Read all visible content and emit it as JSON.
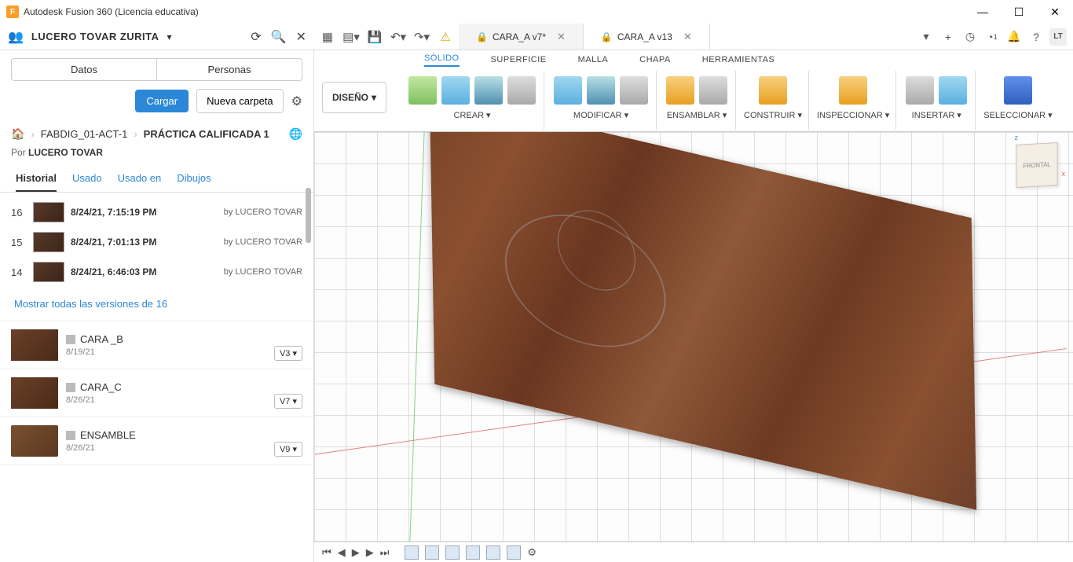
{
  "app": {
    "title": "Autodesk Fusion 360 (Licencia educativa)",
    "user_badge": "LT"
  },
  "user": {
    "name": "LUCERO TOVAR ZURITA"
  },
  "sidebar": {
    "tabs": {
      "datos": "Datos",
      "personas": "Personas"
    },
    "cargar": "Cargar",
    "nueva_carpeta": "Nueva carpeta",
    "breadcrumb": {
      "a": "FABDIG_01-ACT-1",
      "b": "PRÁCTICA CALIFICADA 1"
    },
    "por_prefix": "Por ",
    "por_name": "LUCERO TOVAR",
    "hist_tabs": {
      "historial": "Historial",
      "usado": "Usado",
      "usado_en": "Usado en",
      "dibujos": "Dibujos"
    },
    "versions": [
      {
        "num": "16",
        "date": "8/24/21, 7:15:19 PM",
        "by": "by LUCERO TOVAR"
      },
      {
        "num": "15",
        "date": "8/24/21, 7:01:13 PM",
        "by": "by LUCERO TOVAR"
      },
      {
        "num": "14",
        "date": "8/24/21, 6:46:03 PM",
        "by": "by LUCERO TOVAR"
      }
    ],
    "show_all": "Mostrar todas las versiones de 16",
    "files": [
      {
        "name": "CARA _B",
        "date": "8/19/21",
        "ver": "V3 ▾"
      },
      {
        "name": "CARA_C",
        "date": "8/26/21",
        "ver": "V7 ▾"
      },
      {
        "name": "ENSAMBLE",
        "date": "8/26/21",
        "ver": "V9 ▾"
      }
    ]
  },
  "file_tabs": {
    "tab1": "CARA_A v7*",
    "tab2": "CARA_A v13"
  },
  "ribbon": {
    "workspace": "DISEÑO",
    "tabs": {
      "solido": "SÓLIDO",
      "superficie": "SUPERFICIE",
      "malla": "MALLA",
      "chapa": "CHAPA",
      "herramientas": "HERRAMIENTAS"
    },
    "groups": {
      "crear": "CREAR",
      "modificar": "MODIFICAR",
      "ensamblar": "ENSAMBLAR",
      "construir": "CONSTRUIR",
      "inspeccionar": "INSPECCIONAR",
      "insertar": "INSERTAR",
      "seleccionar": "SELECCIONAR"
    }
  },
  "viewcube": {
    "face": "FRONTAL"
  },
  "badges": {
    "jobs": "1"
  }
}
